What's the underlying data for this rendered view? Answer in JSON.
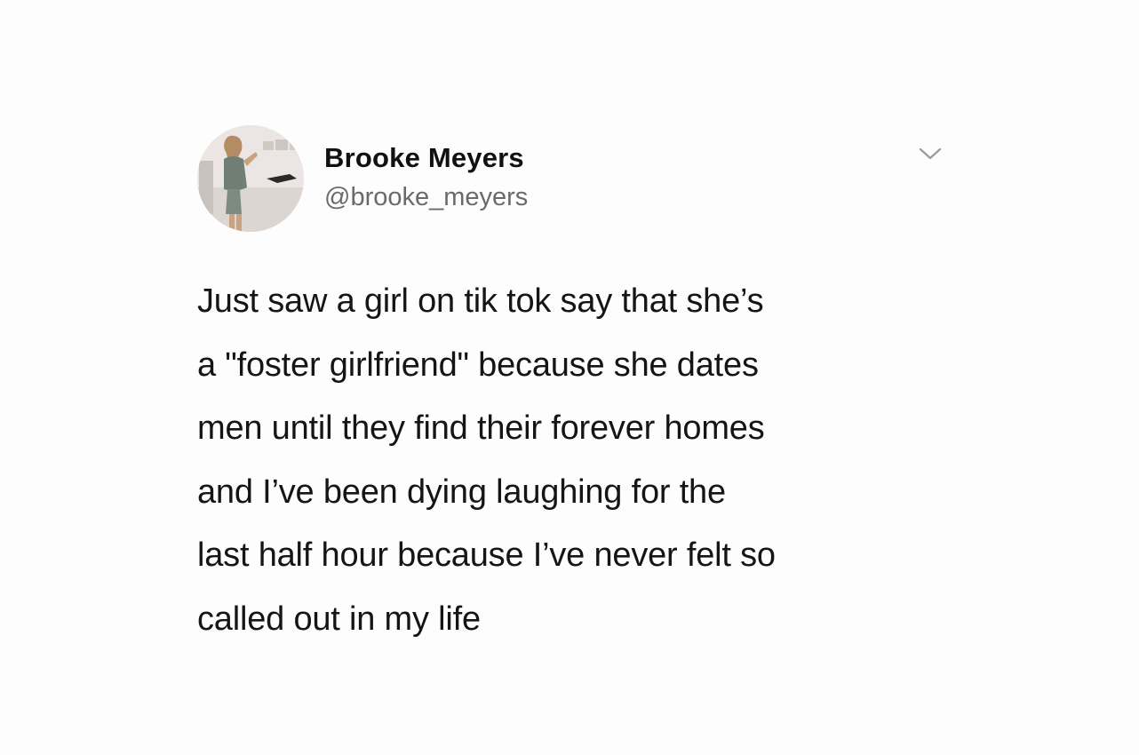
{
  "tweet": {
    "author": {
      "display_name": "Brooke Meyers",
      "handle": "@brooke_meyers",
      "avatar_icon": "profile-photo"
    },
    "menu_icon": "chevron-down-icon",
    "text": "Just saw a girl on tik tok say that she’s\na \"foster girlfriend\" because she dates\nmen until they find their forever homes\nand I’ve been dying laughing for the\nlast half hour because I’ve never felt so\ncalled out in my life"
  },
  "colors": {
    "background": "#fdfdfd",
    "text": "#151515",
    "handle": "#6a6a6a",
    "caret": "#9a9a9a"
  }
}
